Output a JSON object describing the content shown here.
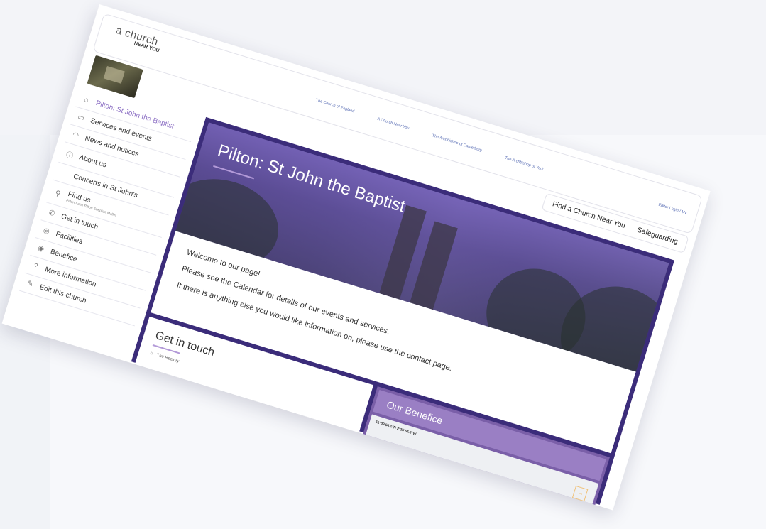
{
  "header": {
    "logo_line1": "a church",
    "logo_line2": "NEAR YOU",
    "top_links": [
      "The Church of England",
      "A Church Near You",
      "The Archbishop of Canterbury",
      "The Archbishop of York"
    ],
    "user_login": "Editor Login / My"
  },
  "secondary_nav": {
    "find_church": "Find a Church Near You",
    "safeguarding": "Safeguarding"
  },
  "sidebar": {
    "items": [
      {
        "label": "Pilton: St John the Baptist",
        "icon": "home-icon",
        "active": true
      },
      {
        "label": "Services and events",
        "icon": "calendar-icon"
      },
      {
        "label": "News and notices",
        "icon": "news-icon"
      },
      {
        "label": "About us",
        "icon": "info-icon"
      },
      {
        "label": "Concerts in St John's",
        "icon": ""
      },
      {
        "label": "Find us",
        "icon": "location-icon",
        "sub": "Pilton Lane Pilton Shepton Mallet"
      },
      {
        "label": "Get in touch",
        "icon": "phone-icon"
      },
      {
        "label": "Facilities",
        "icon": "facilities-icon"
      },
      {
        "label": "Benefice",
        "icon": "benefice-icon"
      },
      {
        "label": "More information",
        "icon": "help-icon"
      },
      {
        "label": "Edit this church",
        "icon": "edit-icon"
      }
    ]
  },
  "hero": {
    "title": "Pilton: St John the Baptist"
  },
  "welcome": {
    "line1": "Welcome to our page!",
    "line2": "Please see the Calendar for details of our events and services.",
    "line3": "If there is anything else you would like information on, please use the contact page."
  },
  "get_in_touch": {
    "title": "Get in touch",
    "address": "The Rectory"
  },
  "benefice": {
    "title": "Our Benefice",
    "coords": "51°09'54.1\"N 2°35'54.8\"W",
    "arrow": "→"
  },
  "colors": {
    "accent_purple": "#3b2c7a",
    "light_purple": "#9a7fc4",
    "link_blue": "#5b6fb5"
  }
}
